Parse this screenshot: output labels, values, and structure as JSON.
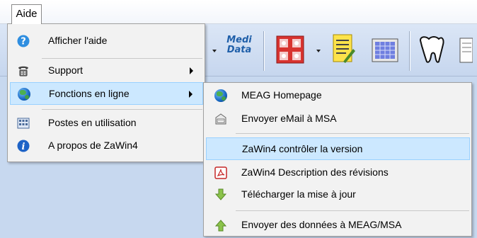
{
  "menubar": {
    "aide_label": "Aide"
  },
  "main_menu": {
    "items": [
      {
        "label": "Afficher l'aide",
        "icon": "help-icon"
      },
      {
        "label": "Support",
        "icon": "telephone-icon"
      },
      {
        "label": "Fonctions en ligne",
        "icon": "globe-icon"
      },
      {
        "label": "Postes en utilisation",
        "icon": "workstations-icon"
      },
      {
        "label": "A propos de  ZaWin4",
        "icon": "info-icon"
      }
    ]
  },
  "submenu": {
    "items": [
      {
        "label": "MEAG Homepage",
        "icon": "globe-icon"
      },
      {
        "label": "Envoyer eMail à MSA",
        "icon": "email-icon"
      },
      {
        "label": "ZaWin4 contrôler la version",
        "icon": ""
      },
      {
        "label": "ZaWin4 Description des révisions",
        "icon": "pdf-icon"
      },
      {
        "label": "Télécharger la mise à jour",
        "icon": "download-arrow-icon"
      },
      {
        "label": "Envoyer des données à MEAG/MSA",
        "icon": "upload-arrow-icon"
      }
    ]
  },
  "toolbar": {
    "medidata_line1": "Medi",
    "medidata_line2": "Data"
  },
  "colors": {
    "highlight": "#cce8ff",
    "highlight_border": "#99d1ff",
    "menu_bg": "#f2f2f2",
    "toolbar_bg": "#c6d6ee"
  }
}
